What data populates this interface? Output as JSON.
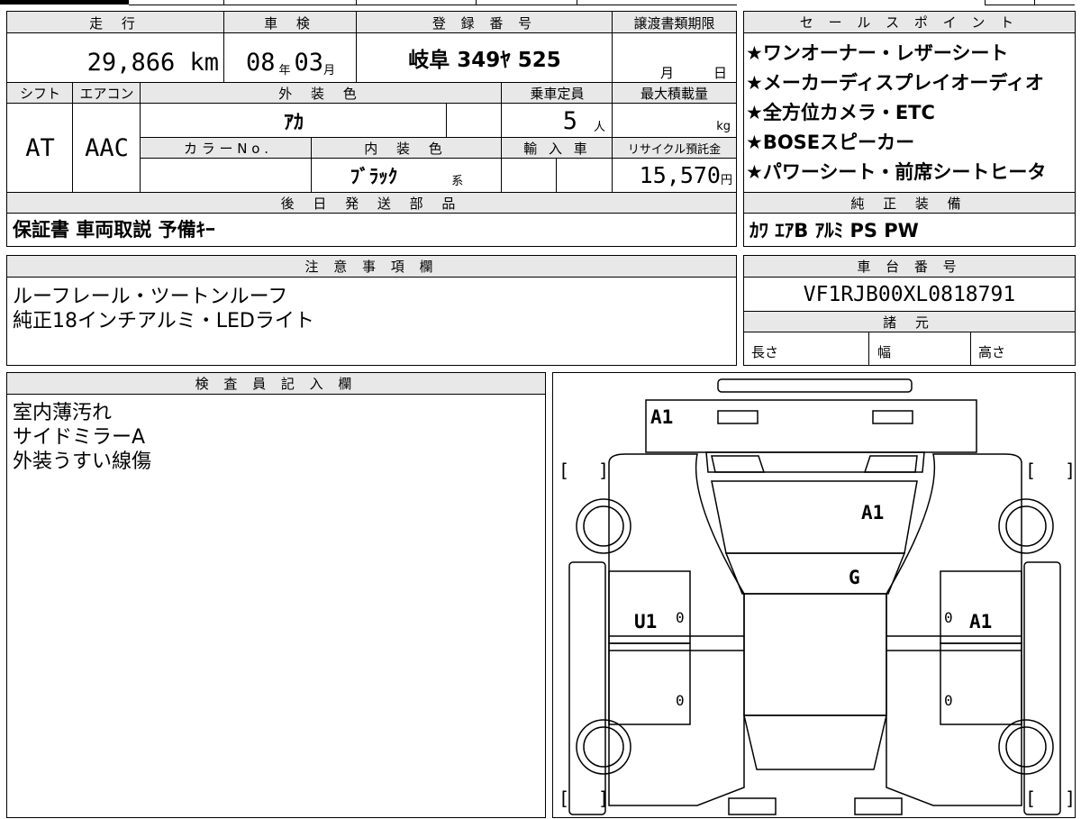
{
  "mileage": {
    "header": "走 行",
    "value": "29,866",
    "unit": "km"
  },
  "inspection": {
    "header": "車 検",
    "year": "08",
    "year_unit": "年",
    "month": "03",
    "month_unit": "月"
  },
  "registration": {
    "header": "登 録 番 号",
    "value": "岐阜 349ﾔ 525"
  },
  "transfer_deadline": {
    "header": "譲渡書類期限",
    "month_unit": "月",
    "day_unit": "日"
  },
  "shift": {
    "header": "シフト",
    "value": "AT"
  },
  "aircon": {
    "header": "エアコン",
    "value": "AAC"
  },
  "exterior_color": {
    "header": "外 装 色",
    "value": "ｱｶ"
  },
  "color_no": {
    "header": "カ ラ ー N o ."
  },
  "interior_color": {
    "header": "内 装 色",
    "value": "ﾌﾞﾗｯｸ",
    "suffix": "系"
  },
  "capacity": {
    "header": "乗車定員",
    "value": "5",
    "unit": "人"
  },
  "max_load": {
    "header": "最大積載量",
    "unit": "kg"
  },
  "import": {
    "header": "輸 入 車"
  },
  "recycle": {
    "header": "リサイクル預託金",
    "value": "15,570",
    "unit": "円"
  },
  "later_parts": {
    "header": "後 日 発 送 部 品",
    "value": "保証書 車両取説 予備ｷｰ"
  },
  "sales_points": {
    "header": "セ ー ル ス ポ イ ン ト",
    "items": [
      "★ワンオーナー・レザーシート",
      "★メーカーディスプレイオーディオ",
      "★全方位カメラ・ETC",
      "★BOSEスピーカー",
      "★パワーシート・前席シートヒータ"
    ]
  },
  "equipment": {
    "header": "純 正 装 備",
    "value": "ｶﾜ ｴｱB ｱﾙﾐ PS PW"
  },
  "notes": {
    "header": "注 意 事 項 欄",
    "lines": [
      "ルーフレール・ツートンルーフ",
      "純正18インチアルミ・LEDライト"
    ]
  },
  "chassis": {
    "header": "車 台 番 号",
    "value": "VF1RJB00XL0818791"
  },
  "specs": {
    "header": "諸 元",
    "length": "長さ",
    "width": "幅",
    "height": "高さ"
  },
  "inspector": {
    "header": "検 査 員 記 入 欄",
    "lines": [
      "室内薄汚れ",
      "サイドミラーA",
      "外装うすい線傷"
    ]
  },
  "diagram": {
    "marks": {
      "rear": "A1",
      "roof": "A1",
      "glass": "G",
      "left": "U1",
      "right": "A1",
      "z1": "0",
      "z2": "0",
      "z3": "0",
      "z4": "0"
    },
    "bracket_open": "[",
    "bracket_close": "]"
  }
}
